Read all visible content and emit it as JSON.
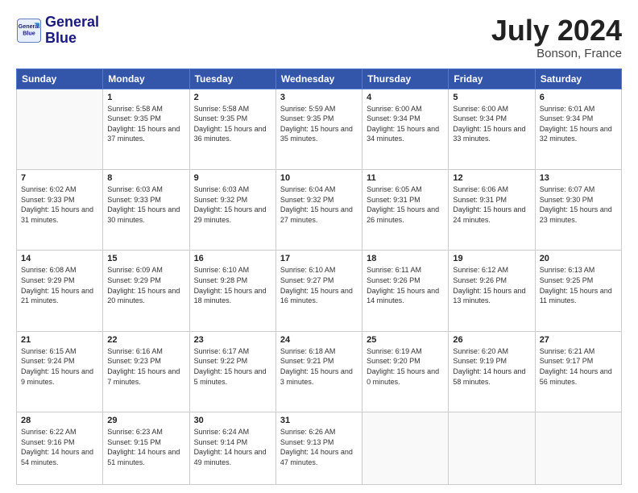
{
  "logo": {
    "line1": "General",
    "line2": "Blue"
  },
  "title": "July 2024",
  "location": "Bonson, France",
  "weekdays": [
    "Sunday",
    "Monday",
    "Tuesday",
    "Wednesday",
    "Thursday",
    "Friday",
    "Saturday"
  ],
  "days": [
    {
      "num": "",
      "sunrise": "",
      "sunset": "",
      "daylight": ""
    },
    {
      "num": "1",
      "sunrise": "Sunrise: 5:58 AM",
      "sunset": "Sunset: 9:35 PM",
      "daylight": "Daylight: 15 hours and 37 minutes."
    },
    {
      "num": "2",
      "sunrise": "Sunrise: 5:58 AM",
      "sunset": "Sunset: 9:35 PM",
      "daylight": "Daylight: 15 hours and 36 minutes."
    },
    {
      "num": "3",
      "sunrise": "Sunrise: 5:59 AM",
      "sunset": "Sunset: 9:35 PM",
      "daylight": "Daylight: 15 hours and 35 minutes."
    },
    {
      "num": "4",
      "sunrise": "Sunrise: 6:00 AM",
      "sunset": "Sunset: 9:34 PM",
      "daylight": "Daylight: 15 hours and 34 minutes."
    },
    {
      "num": "5",
      "sunrise": "Sunrise: 6:00 AM",
      "sunset": "Sunset: 9:34 PM",
      "daylight": "Daylight: 15 hours and 33 minutes."
    },
    {
      "num": "6",
      "sunrise": "Sunrise: 6:01 AM",
      "sunset": "Sunset: 9:34 PM",
      "daylight": "Daylight: 15 hours and 32 minutes."
    },
    {
      "num": "7",
      "sunrise": "Sunrise: 6:02 AM",
      "sunset": "Sunset: 9:33 PM",
      "daylight": "Daylight: 15 hours and 31 minutes."
    },
    {
      "num": "8",
      "sunrise": "Sunrise: 6:03 AM",
      "sunset": "Sunset: 9:33 PM",
      "daylight": "Daylight: 15 hours and 30 minutes."
    },
    {
      "num": "9",
      "sunrise": "Sunrise: 6:03 AM",
      "sunset": "Sunset: 9:32 PM",
      "daylight": "Daylight: 15 hours and 29 minutes."
    },
    {
      "num": "10",
      "sunrise": "Sunrise: 6:04 AM",
      "sunset": "Sunset: 9:32 PM",
      "daylight": "Daylight: 15 hours and 27 minutes."
    },
    {
      "num": "11",
      "sunrise": "Sunrise: 6:05 AM",
      "sunset": "Sunset: 9:31 PM",
      "daylight": "Daylight: 15 hours and 26 minutes."
    },
    {
      "num": "12",
      "sunrise": "Sunrise: 6:06 AM",
      "sunset": "Sunset: 9:31 PM",
      "daylight": "Daylight: 15 hours and 24 minutes."
    },
    {
      "num": "13",
      "sunrise": "Sunrise: 6:07 AM",
      "sunset": "Sunset: 9:30 PM",
      "daylight": "Daylight: 15 hours and 23 minutes."
    },
    {
      "num": "14",
      "sunrise": "Sunrise: 6:08 AM",
      "sunset": "Sunset: 9:29 PM",
      "daylight": "Daylight: 15 hours and 21 minutes."
    },
    {
      "num": "15",
      "sunrise": "Sunrise: 6:09 AM",
      "sunset": "Sunset: 9:29 PM",
      "daylight": "Daylight: 15 hours and 20 minutes."
    },
    {
      "num": "16",
      "sunrise": "Sunrise: 6:10 AM",
      "sunset": "Sunset: 9:28 PM",
      "daylight": "Daylight: 15 hours and 18 minutes."
    },
    {
      "num": "17",
      "sunrise": "Sunrise: 6:10 AM",
      "sunset": "Sunset: 9:27 PM",
      "daylight": "Daylight: 15 hours and 16 minutes."
    },
    {
      "num": "18",
      "sunrise": "Sunrise: 6:11 AM",
      "sunset": "Sunset: 9:26 PM",
      "daylight": "Daylight: 15 hours and 14 minutes."
    },
    {
      "num": "19",
      "sunrise": "Sunrise: 6:12 AM",
      "sunset": "Sunset: 9:26 PM",
      "daylight": "Daylight: 15 hours and 13 minutes."
    },
    {
      "num": "20",
      "sunrise": "Sunrise: 6:13 AM",
      "sunset": "Sunset: 9:25 PM",
      "daylight": "Daylight: 15 hours and 11 minutes."
    },
    {
      "num": "21",
      "sunrise": "Sunrise: 6:15 AM",
      "sunset": "Sunset: 9:24 PM",
      "daylight": "Daylight: 15 hours and 9 minutes."
    },
    {
      "num": "22",
      "sunrise": "Sunrise: 6:16 AM",
      "sunset": "Sunset: 9:23 PM",
      "daylight": "Daylight: 15 hours and 7 minutes."
    },
    {
      "num": "23",
      "sunrise": "Sunrise: 6:17 AM",
      "sunset": "Sunset: 9:22 PM",
      "daylight": "Daylight: 15 hours and 5 minutes."
    },
    {
      "num": "24",
      "sunrise": "Sunrise: 6:18 AM",
      "sunset": "Sunset: 9:21 PM",
      "daylight": "Daylight: 15 hours and 3 minutes."
    },
    {
      "num": "25",
      "sunrise": "Sunrise: 6:19 AM",
      "sunset": "Sunset: 9:20 PM",
      "daylight": "Daylight: 15 hours and 0 minutes."
    },
    {
      "num": "26",
      "sunrise": "Sunrise: 6:20 AM",
      "sunset": "Sunset: 9:19 PM",
      "daylight": "Daylight: 14 hours and 58 minutes."
    },
    {
      "num": "27",
      "sunrise": "Sunrise: 6:21 AM",
      "sunset": "Sunset: 9:17 PM",
      "daylight": "Daylight: 14 hours and 56 minutes."
    },
    {
      "num": "28",
      "sunrise": "Sunrise: 6:22 AM",
      "sunset": "Sunset: 9:16 PM",
      "daylight": "Daylight: 14 hours and 54 minutes."
    },
    {
      "num": "29",
      "sunrise": "Sunrise: 6:23 AM",
      "sunset": "Sunset: 9:15 PM",
      "daylight": "Daylight: 14 hours and 51 minutes."
    },
    {
      "num": "30",
      "sunrise": "Sunrise: 6:24 AM",
      "sunset": "Sunset: 9:14 PM",
      "daylight": "Daylight: 14 hours and 49 minutes."
    },
    {
      "num": "31",
      "sunrise": "Sunrise: 6:26 AM",
      "sunset": "Sunset: 9:13 PM",
      "daylight": "Daylight: 14 hours and 47 minutes."
    },
    {
      "num": "",
      "sunrise": "",
      "sunset": "",
      "daylight": ""
    },
    {
      "num": "",
      "sunrise": "",
      "sunset": "",
      "daylight": ""
    },
    {
      "num": "",
      "sunrise": "",
      "sunset": "",
      "daylight": ""
    }
  ]
}
